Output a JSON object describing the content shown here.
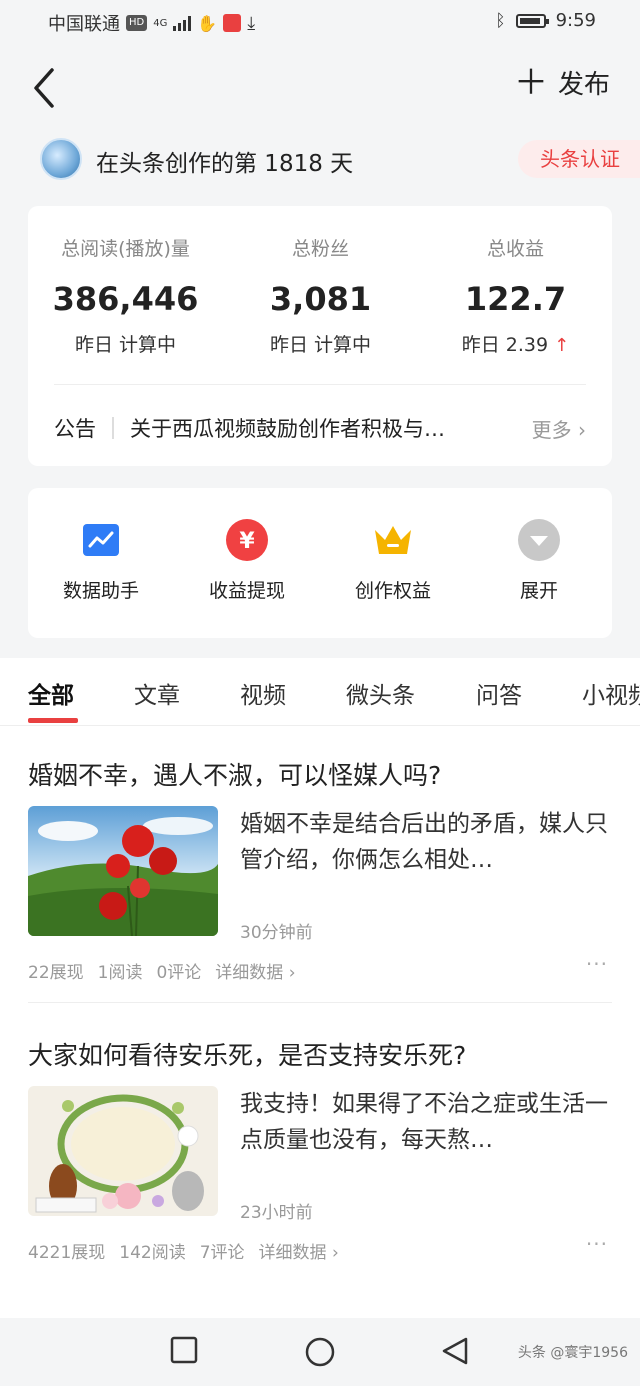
{
  "status_bar": {
    "carrier": "中国联通",
    "hd": "HD",
    "network": "4G",
    "time": "9:59"
  },
  "nav": {
    "publish_label": "发布"
  },
  "creator": {
    "days_text": "在头条创作的第 1818 天",
    "cert_label": "头条认证"
  },
  "stats": [
    {
      "label": "总阅读(播放)量",
      "value": "386,446",
      "sub": "昨日 计算中"
    },
    {
      "label": "总粉丝",
      "value": "3,081",
      "sub": "昨日 计算中"
    },
    {
      "label": "总收益",
      "value": "122.7",
      "sub": "昨日 2.39"
    }
  ],
  "notice": {
    "label": "公告",
    "text": "关于西瓜视频鼓励创作者积极与…",
    "more": "更多"
  },
  "tools": [
    {
      "label": "数据助手",
      "icon": "chart-icon",
      "color": "#2f7cf6"
    },
    {
      "label": "收益提现",
      "icon": "yuan-icon",
      "color": "#f04142"
    },
    {
      "label": "创作权益",
      "icon": "crown-icon",
      "color": "#f5b400"
    },
    {
      "label": "展开",
      "icon": "expand-icon",
      "color": "#c4c4c4"
    }
  ],
  "tabs": [
    "全部",
    "文章",
    "视频",
    "微头条",
    "问答",
    "小视频"
  ],
  "posts": [
    {
      "title": "婚姻不幸，遇人不淑，可以怪媒人吗?",
      "snippet": "婚姻不幸是结合后出的矛盾，媒人只管介绍，你俩怎么相处…",
      "time": "30分钟前",
      "views": "22展现",
      "reads": "1阅读",
      "comments": "0评论",
      "detail": "详细数据 ›"
    },
    {
      "title": "大家如何看待安乐死，是否支持安乐死?",
      "snippet": "我支持！如果得了不治之症或生活一点质量也没有，每天熬…",
      "time": "23小时前",
      "views": "4221展现",
      "reads": "142阅读",
      "comments": "7评论",
      "detail": "详细数据 ›"
    }
  ],
  "watermark": "头条 @寰宇1956",
  "colors": {
    "accent": "#e94040",
    "background": "#f4f5f6"
  }
}
